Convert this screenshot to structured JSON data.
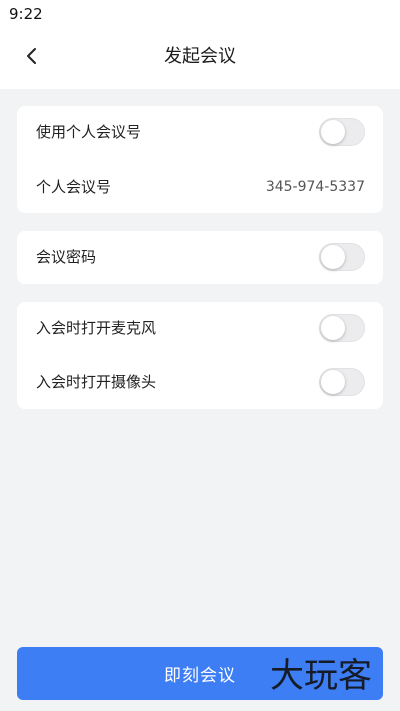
{
  "status_bar": {
    "time": "9:22"
  },
  "header": {
    "back_icon": "chevron-left-icon",
    "title": "发起会议"
  },
  "settings": {
    "personal_meeting": {
      "use_pmi_label": "使用个人会议号",
      "use_pmi_enabled": false,
      "pmi_label": "个人会议号",
      "pmi_value": "345-974-5337"
    },
    "password": {
      "label": "会议密码",
      "enabled": false
    },
    "media": {
      "mic_label": "入会时打开麦克风",
      "mic_enabled": false,
      "camera_label": "入会时打开摄像头",
      "camera_enabled": false
    }
  },
  "actions": {
    "start_label": "即刻会议"
  },
  "watermark": "大玩客",
  "colors": {
    "accent": "#3d7ef5",
    "background": "#f2f3f5",
    "toggle_off": "#ececee"
  }
}
